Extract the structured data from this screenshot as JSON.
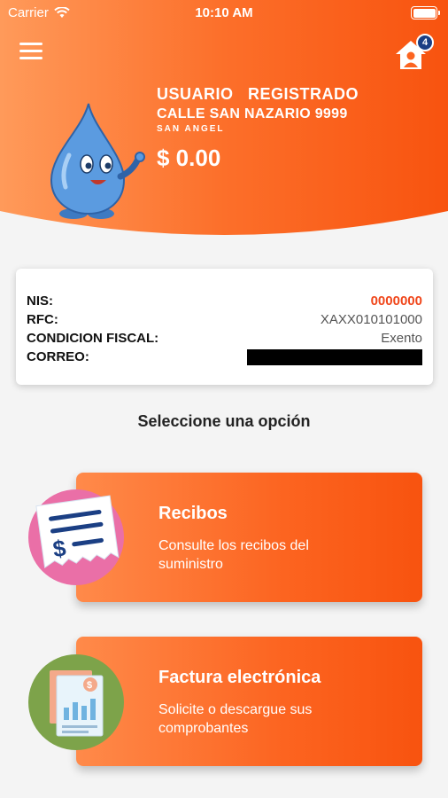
{
  "status_bar": {
    "carrier": "Carrier",
    "time": "10:10 AM"
  },
  "header": {
    "notifications_count": "4"
  },
  "user": {
    "name": "USUARIO   REGISTRADO",
    "address": "CALLE SAN NAZARIO 9999",
    "area": "SAN ANGEL",
    "balance": "$ 0.00"
  },
  "info": {
    "nis_label": "NIS:",
    "nis_value": "0000000",
    "rfc_label": "RFC:",
    "rfc_value": "XAXX010101000",
    "fiscal_label": "CONDICION FISCAL:",
    "fiscal_value": "Exento",
    "email_label": "CORREO:"
  },
  "prompt": "Seleccione una opción",
  "options": [
    {
      "title": "Recibos",
      "desc": "Consulte los recibos del suministro",
      "icon": "receipt-icon"
    },
    {
      "title": "Factura electrónica",
      "desc": "Solicite o descargue sus comprobantes",
      "icon": "invoice-icon"
    }
  ],
  "colors": {
    "accent": "#fc6420",
    "badge": "#1b3f84",
    "nis": "#f0461a"
  }
}
